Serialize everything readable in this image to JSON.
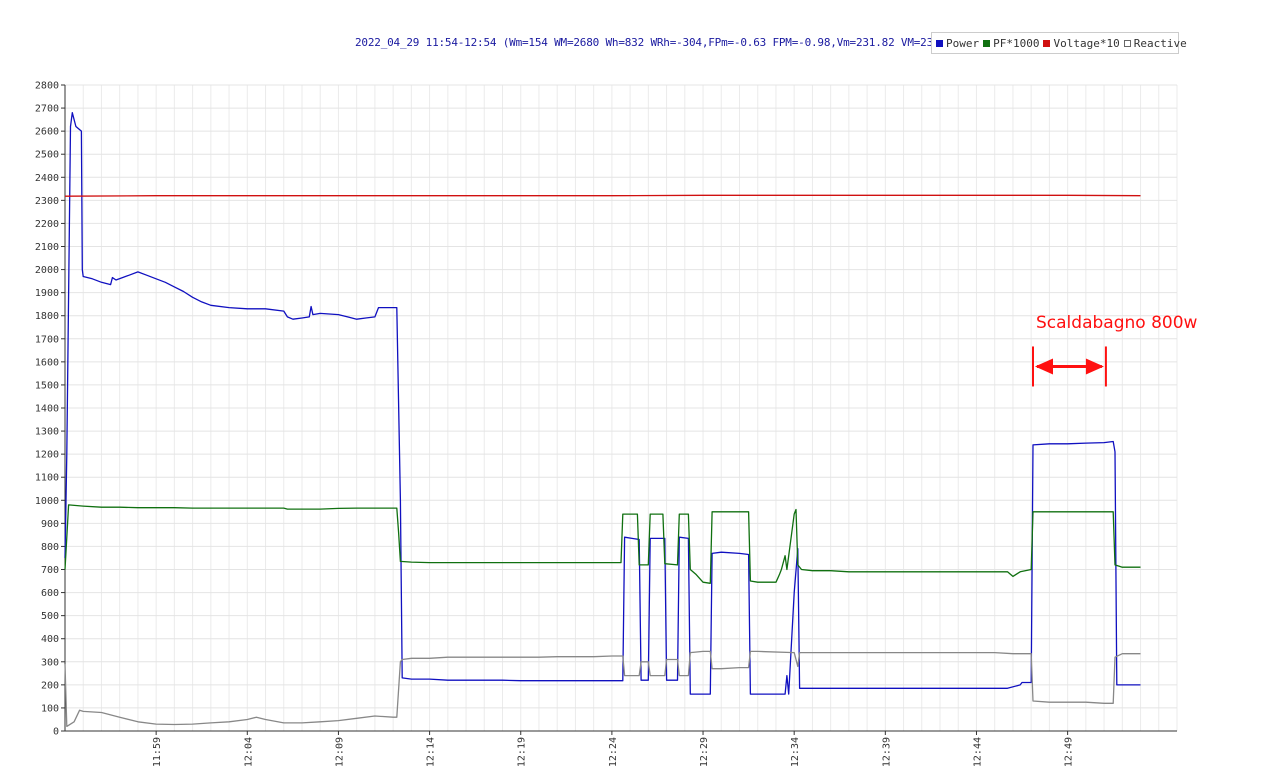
{
  "chart_data": {
    "type": "line",
    "title": "2022_04_29 11:54-12:54 (Wm=154 WM=2680 Wh=832 WRh=-304,FPm=-0.63 FPM=-0.98,Vm=231.82 VM=232.59)",
    "xlabel": "",
    "ylabel": "",
    "x_range_minutes": [
      0,
      61
    ],
    "ylim": [
      0,
      2800
    ],
    "grid": true,
    "legend_position": "top-right",
    "y_ticks": [
      "0",
      "100",
      "200",
      "300",
      "400",
      "500",
      "600",
      "700",
      "800",
      "900",
      "1000",
      "1100",
      "1200",
      "1300",
      "1400",
      "1500",
      "1600",
      "1700",
      "1800",
      "1900",
      "2000",
      "2100",
      "2200",
      "2300",
      "2400",
      "2500",
      "2600",
      "2700",
      "2800"
    ],
    "x_ticks": [
      {
        "label": "11:59",
        "t": 5
      },
      {
        "label": "12:04",
        "t": 10
      },
      {
        "label": "12:09",
        "t": 15
      },
      {
        "label": "12:14",
        "t": 20
      },
      {
        "label": "12:19",
        "t": 25
      },
      {
        "label": "12:24",
        "t": 30
      },
      {
        "label": "12:29",
        "t": 35
      },
      {
        "label": "12:34",
        "t": 40
      },
      {
        "label": "12:39",
        "t": 45
      },
      {
        "label": "12:44",
        "t": 50
      },
      {
        "label": "12:49",
        "t": 55
      }
    ],
    "series": [
      {
        "name": "Power",
        "color": "#1010c0",
        "points": [
          [
            0,
            750
          ],
          [
            0.1,
            1200
          ],
          [
            0.3,
            2620
          ],
          [
            0.4,
            2680
          ],
          [
            0.6,
            2620
          ],
          [
            0.9,
            2600
          ],
          [
            0.95,
            2000
          ],
          [
            1.0,
            1970
          ],
          [
            1.5,
            1960
          ],
          [
            2.0,
            1945
          ],
          [
            2.5,
            1935
          ],
          [
            2.6,
            1965
          ],
          [
            2.8,
            1955
          ],
          [
            3.5,
            1975
          ],
          [
            4.0,
            1990
          ],
          [
            4.5,
            1975
          ],
          [
            5.0,
            1960
          ],
          [
            5.5,
            1945
          ],
          [
            6.0,
            1925
          ],
          [
            6.5,
            1905
          ],
          [
            7.0,
            1880
          ],
          [
            7.5,
            1860
          ],
          [
            8.0,
            1845
          ],
          [
            9,
            1835
          ],
          [
            10,
            1830
          ],
          [
            11,
            1830
          ],
          [
            12,
            1820
          ],
          [
            12.2,
            1795
          ],
          [
            12.5,
            1785
          ],
          [
            13,
            1790
          ],
          [
            13.4,
            1795
          ],
          [
            13.5,
            1840
          ],
          [
            13.6,
            1805
          ],
          [
            14,
            1810
          ],
          [
            15,
            1805
          ],
          [
            15.5,
            1795
          ],
          [
            16,
            1785
          ],
          [
            16.5,
            1790
          ],
          [
            17.0,
            1795
          ],
          [
            17.2,
            1835
          ],
          [
            18,
            1835
          ],
          [
            18.2,
            1835
          ],
          [
            18.4,
            1000
          ],
          [
            18.5,
            230
          ],
          [
            19,
            225
          ],
          [
            20,
            225
          ],
          [
            21,
            220
          ],
          [
            22,
            220
          ],
          [
            23,
            220
          ],
          [
            24,
            220
          ],
          [
            25,
            218
          ],
          [
            26,
            218
          ],
          [
            27,
            218
          ],
          [
            28,
            218
          ],
          [
            29,
            218
          ],
          [
            30,
            218
          ],
          [
            30.6,
            218
          ],
          [
            30.7,
            840
          ],
          [
            31.5,
            830
          ],
          [
            31.6,
            220
          ],
          [
            32.0,
            220
          ],
          [
            32.1,
            835
          ],
          [
            32.9,
            835
          ],
          [
            33.0,
            220
          ],
          [
            33.6,
            220
          ],
          [
            33.7,
            840
          ],
          [
            34.2,
            835
          ],
          [
            34.3,
            160
          ],
          [
            35,
            160
          ],
          [
            35.4,
            160
          ],
          [
            35.5,
            770
          ],
          [
            36,
            775
          ],
          [
            37,
            770
          ],
          [
            37.5,
            765
          ],
          [
            37.6,
            160
          ],
          [
            38,
            160
          ],
          [
            38.5,
            160
          ],
          [
            39,
            160
          ],
          [
            39.5,
            160
          ],
          [
            39.6,
            240
          ],
          [
            39.7,
            160
          ],
          [
            40.0,
            600
          ],
          [
            40.2,
            790
          ],
          [
            40.3,
            185
          ],
          [
            41,
            185
          ],
          [
            42,
            185
          ],
          [
            43,
            185
          ],
          [
            44,
            185
          ],
          [
            45,
            185
          ],
          [
            46,
            185
          ],
          [
            47,
            185
          ],
          [
            48,
            185
          ],
          [
            49,
            185
          ],
          [
            50,
            185
          ],
          [
            51,
            185
          ],
          [
            51.7,
            185
          ],
          [
            52.4,
            200
          ],
          [
            52.5,
            210
          ],
          [
            53.0,
            210
          ],
          [
            53.1,
            1240
          ],
          [
            54,
            1245
          ],
          [
            55,
            1245
          ],
          [
            56,
            1248
          ],
          [
            57,
            1250
          ],
          [
            57.5,
            1255
          ],
          [
            57.6,
            1210
          ],
          [
            57.7,
            200
          ],
          [
            58,
            200
          ],
          [
            58.5,
            200
          ],
          [
            59,
            200
          ]
        ]
      },
      {
        "name": "PF*1000",
        "color": "#107010",
        "points": [
          [
            0,
            700
          ],
          [
            0.2,
            980
          ],
          [
            1,
            975
          ],
          [
            2,
            970
          ],
          [
            3,
            970
          ],
          [
            4,
            968
          ],
          [
            5,
            968
          ],
          [
            6,
            968
          ],
          [
            7,
            966
          ],
          [
            8,
            966
          ],
          [
            9,
            966
          ],
          [
            10,
            966
          ],
          [
            11,
            966
          ],
          [
            12,
            966
          ],
          [
            12.2,
            962
          ],
          [
            13,
            962
          ],
          [
            14,
            962
          ],
          [
            15,
            965
          ],
          [
            16,
            966
          ],
          [
            17,
            966
          ],
          [
            18,
            966
          ],
          [
            18.2,
            966
          ],
          [
            18.3,
            860
          ],
          [
            18.4,
            735
          ],
          [
            19,
            732
          ],
          [
            20,
            730
          ],
          [
            21,
            730
          ],
          [
            22,
            730
          ],
          [
            23,
            730
          ],
          [
            24,
            730
          ],
          [
            25,
            730
          ],
          [
            26,
            730
          ],
          [
            27,
            730
          ],
          [
            28,
            730
          ],
          [
            29,
            730
          ],
          [
            30,
            730
          ],
          [
            30.5,
            730
          ],
          [
            30.6,
            940
          ],
          [
            31.4,
            940
          ],
          [
            31.5,
            720
          ],
          [
            32.0,
            720
          ],
          [
            32.1,
            940
          ],
          [
            32.8,
            940
          ],
          [
            32.9,
            725
          ],
          [
            33.6,
            720
          ],
          [
            33.7,
            940
          ],
          [
            34.2,
            940
          ],
          [
            34.3,
            700
          ],
          [
            34.6,
            680
          ],
          [
            35,
            645
          ],
          [
            35.4,
            640
          ],
          [
            35.5,
            950
          ],
          [
            37.0,
            950
          ],
          [
            37.5,
            950
          ],
          [
            37.6,
            650
          ],
          [
            38,
            645
          ],
          [
            38.5,
            645
          ],
          [
            39,
            645
          ],
          [
            39.2,
            680
          ],
          [
            39.3,
            700
          ],
          [
            39.5,
            760
          ],
          [
            39.6,
            700
          ],
          [
            40.0,
            940
          ],
          [
            40.1,
            960
          ],
          [
            40.2,
            720
          ],
          [
            40.4,
            700
          ],
          [
            41,
            695
          ],
          [
            42,
            695
          ],
          [
            43,
            690
          ],
          [
            44,
            690
          ],
          [
            45,
            690
          ],
          [
            46,
            690
          ],
          [
            47,
            690
          ],
          [
            48,
            690
          ],
          [
            49,
            690
          ],
          [
            50,
            690
          ],
          [
            51,
            690
          ],
          [
            51.7,
            690
          ],
          [
            52,
            670
          ],
          [
            52.4,
            690
          ],
          [
            53,
            700
          ],
          [
            53.1,
            950
          ],
          [
            54,
            950
          ],
          [
            55,
            950
          ],
          [
            56,
            950
          ],
          [
            57,
            950
          ],
          [
            57.5,
            950
          ],
          [
            57.6,
            720
          ],
          [
            58,
            710
          ],
          [
            59,
            710
          ]
        ]
      },
      {
        "name": "Voltage*10",
        "color": "#d01010",
        "points": [
          [
            0,
            2318
          ],
          [
            5,
            2320
          ],
          [
            10,
            2320
          ],
          [
            15,
            2320
          ],
          [
            20,
            2320
          ],
          [
            25,
            2320
          ],
          [
            30,
            2320
          ],
          [
            35,
            2322
          ],
          [
            40,
            2322
          ],
          [
            45,
            2322
          ],
          [
            50,
            2322
          ],
          [
            55,
            2322
          ],
          [
            59,
            2320
          ]
        ]
      },
      {
        "name": "Reactive",
        "color": "#888888",
        "points": [
          [
            0,
            290
          ],
          [
            0.1,
            20
          ],
          [
            0.5,
            40
          ],
          [
            0.8,
            90
          ],
          [
            1,
            85
          ],
          [
            2,
            80
          ],
          [
            3,
            60
          ],
          [
            4,
            40
          ],
          [
            5,
            30
          ],
          [
            6,
            28
          ],
          [
            7,
            30
          ],
          [
            8,
            35
          ],
          [
            9,
            40
          ],
          [
            10,
            50
          ],
          [
            10.5,
            60
          ],
          [
            11,
            50
          ],
          [
            12,
            35
          ],
          [
            13,
            35
          ],
          [
            14,
            40
          ],
          [
            15,
            45
          ],
          [
            16,
            55
          ],
          [
            17,
            65
          ],
          [
            18,
            60
          ],
          [
            18.2,
            60
          ],
          [
            18.4,
            300
          ],
          [
            18.5,
            310
          ],
          [
            19,
            315
          ],
          [
            20,
            315
          ],
          [
            21,
            320
          ],
          [
            22,
            320
          ],
          [
            23,
            320
          ],
          [
            24,
            320
          ],
          [
            25,
            320
          ],
          [
            26,
            320
          ],
          [
            27,
            322
          ],
          [
            28,
            322
          ],
          [
            29,
            322
          ],
          [
            30,
            325
          ],
          [
            30.6,
            325
          ],
          [
            30.7,
            240
          ],
          [
            31.5,
            240
          ],
          [
            31.6,
            300
          ],
          [
            32.0,
            300
          ],
          [
            32.1,
            240
          ],
          [
            32.9,
            240
          ],
          [
            33.0,
            310
          ],
          [
            33.6,
            310
          ],
          [
            33.7,
            240
          ],
          [
            34.2,
            240
          ],
          [
            34.3,
            340
          ],
          [
            35,
            345
          ],
          [
            35.4,
            345
          ],
          [
            35.5,
            270
          ],
          [
            36,
            270
          ],
          [
            37,
            275
          ],
          [
            37.5,
            275
          ],
          [
            37.6,
            345
          ],
          [
            38,
            345
          ],
          [
            40,
            340
          ],
          [
            40.2,
            280
          ],
          [
            40.3,
            340
          ],
          [
            41,
            340
          ],
          [
            42,
            340
          ],
          [
            43,
            340
          ],
          [
            44,
            340
          ],
          [
            45,
            340
          ],
          [
            46,
            340
          ],
          [
            47,
            340
          ],
          [
            48,
            340
          ],
          [
            49,
            340
          ],
          [
            50,
            340
          ],
          [
            51,
            340
          ],
          [
            52,
            335
          ],
          [
            53,
            335
          ],
          [
            53.1,
            130
          ],
          [
            54,
            125
          ],
          [
            55,
            125
          ],
          [
            56,
            125
          ],
          [
            57,
            120
          ],
          [
            57.5,
            120
          ],
          [
            57.6,
            320
          ],
          [
            58,
            335
          ],
          [
            59,
            335
          ]
        ]
      }
    ],
    "annotation": {
      "text": "Scaldabagno 800w",
      "arrow_from_t": 53.1,
      "arrow_to_t": 57.1,
      "arrow_y": 1580
    }
  },
  "legend": {
    "items": [
      {
        "label": "Power",
        "color": "#1010c0"
      },
      {
        "label": "PF*1000",
        "color": "#107010"
      },
      {
        "label": "Voltage*10",
        "color": "#d01010"
      },
      {
        "label": "Reactive",
        "color": "#ffffff"
      }
    ]
  }
}
